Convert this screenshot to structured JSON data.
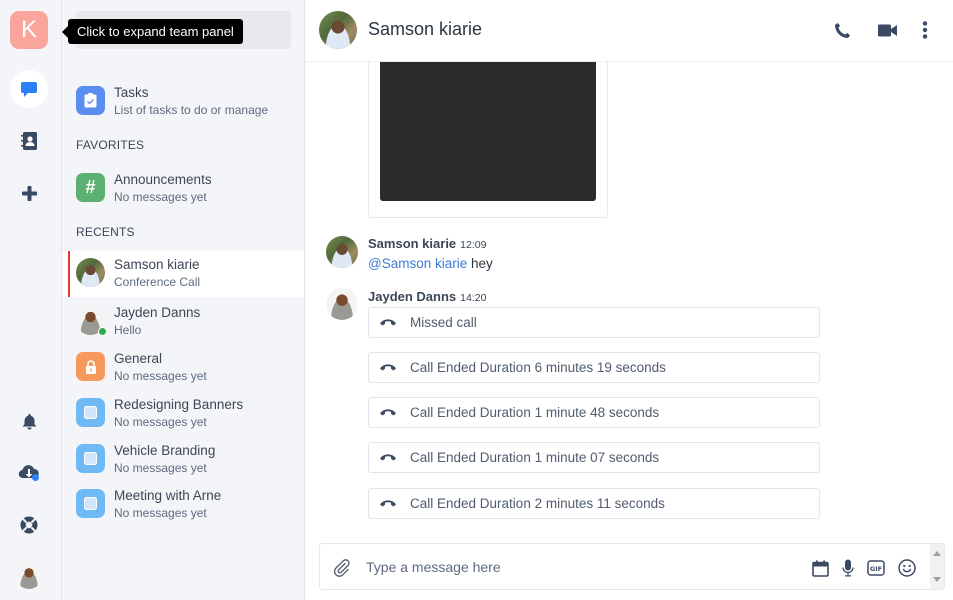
{
  "rail": {
    "team_initial": "K",
    "team_color": "#f9a59b",
    "tooltip": "Click to expand team panel",
    "icons": [
      "chat-icon",
      "contacts-icon",
      "plus-icon",
      "bell-icon",
      "cloud-download-icon",
      "lifebuoy-icon"
    ]
  },
  "sidebar": {
    "tasks": {
      "name": "Tasks",
      "subtitle": "List of tasks to do or manage",
      "color": "#5b8def"
    },
    "favorites_title": "FAVORITES",
    "favorites": [
      {
        "name": "Announcements",
        "subtitle": "No messages yet",
        "icon": "hash-icon",
        "icon_glyph": "#",
        "color": "#5cb071"
      }
    ],
    "recents_title": "RECENTS",
    "recents": [
      {
        "name": "Samson kiarie",
        "subtitle": "Conference Call",
        "type": "user",
        "selected": true
      },
      {
        "name": "Jayden Danns",
        "subtitle": "Hello",
        "type": "user",
        "online": true
      },
      {
        "name": "General",
        "subtitle": "No messages yet",
        "icon": "lock-icon",
        "color": "#f7995c"
      },
      {
        "name": "Redesigning Banners",
        "subtitle": "No messages yet",
        "icon": "square-icon",
        "color": "#6fb9f5"
      },
      {
        "name": "Vehicle Branding",
        "subtitle": "No messages yet",
        "icon": "square-icon",
        "color": "#6fb9f5"
      },
      {
        "name": "Meeting with Arne",
        "subtitle": "No messages yet",
        "icon": "square-icon",
        "color": "#6fb9f5"
      }
    ]
  },
  "chat": {
    "title": "Samson kiarie",
    "header_actions": [
      "phone-icon",
      "video-icon",
      "more-vertical-icon"
    ],
    "messages": [
      {
        "author": "Samson kiarie",
        "time": "12:09",
        "mention": "@Samson kiarie",
        "text": " hey"
      },
      {
        "author": "Jayden Danns",
        "time": "14:20",
        "calls": [
          "Missed call",
          "Call Ended Duration 6 minutes 19 seconds",
          "Call Ended Duration 1 minute 48 seconds",
          "Call Ended Duration 1 minute 07 seconds",
          "Call Ended Duration 2 minutes 11 seconds"
        ]
      }
    ],
    "composer": {
      "placeholder": "Type a message here",
      "value": "",
      "actions": [
        "calendar-icon",
        "microphone-icon",
        "gif-icon",
        "emoji-icon"
      ]
    }
  },
  "colors": {
    "accent": "#2d7ff9",
    "selected_bar": "#e53935",
    "icon_dark": "#3b4a63",
    "mention": "#3a7bd5",
    "online": "#2eaa4f"
  }
}
